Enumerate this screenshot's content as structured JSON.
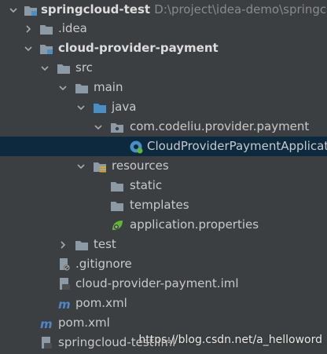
{
  "tree": {
    "root": {
      "label": "springcloud-test",
      "path": "D:\\project\\idea-demo\\springcloud-test"
    },
    "idea_folder": {
      "label": ".idea"
    },
    "module": {
      "label": "cloud-provider-payment"
    },
    "src": {
      "label": "src"
    },
    "main": {
      "label": "main"
    },
    "java": {
      "label": "java"
    },
    "package": {
      "label": "com.codeliu.provider.payment"
    },
    "app_class": {
      "label": "CloudProviderPaymentApplication"
    },
    "resources": {
      "label": "resources"
    },
    "static": {
      "label": "static"
    },
    "templates": {
      "label": "templates"
    },
    "app_props": {
      "label": "application.properties"
    },
    "test": {
      "label": "test"
    },
    "gitignore": {
      "label": ".gitignore"
    },
    "module_iml": {
      "label": "cloud-provider-payment.iml"
    },
    "module_pom": {
      "label": "pom.xml"
    },
    "root_pom": {
      "label": "pom.xml"
    },
    "root_iml": {
      "label": "springcloud-test.iml"
    }
  },
  "watermark": {
    "text": "https://blog.csdn.net/a_helloword"
  },
  "colors": {
    "background": "#3c3f41",
    "selection": "#0d293e",
    "folder": "#8c9aa6",
    "source_folder": "#4a8fc4",
    "spring_green": "#5fb832",
    "maven": "#4f86c6"
  }
}
